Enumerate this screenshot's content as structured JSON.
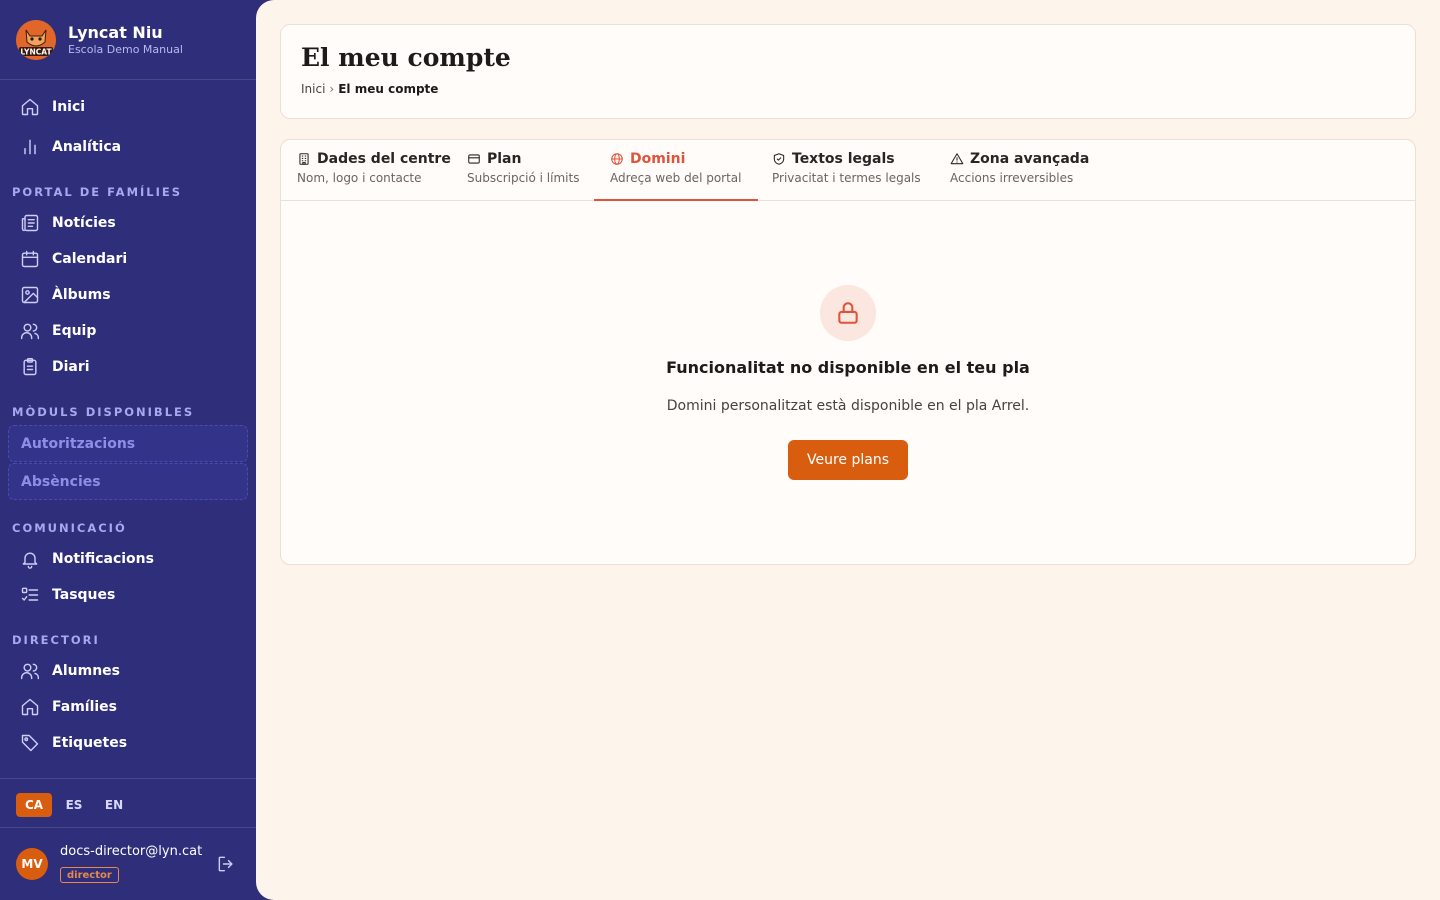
{
  "brand": {
    "name": "Lyncat Niu",
    "subtitle": "Escola Demo Manual",
    "logo_text": "LYNCAT"
  },
  "sidebar": {
    "main_items": [
      {
        "label": "Inici",
        "icon": "home-icon"
      },
      {
        "label": "Analítica",
        "icon": "bar-chart-icon"
      }
    ],
    "sections": [
      {
        "title": "PORTAL DE FAMÍLIES",
        "items": [
          {
            "label": "Notícies",
            "icon": "newspaper-icon"
          },
          {
            "label": "Calendari",
            "icon": "calendar-icon"
          },
          {
            "label": "Àlbums",
            "icon": "image-icon"
          },
          {
            "label": "Equip",
            "icon": "users-icon"
          },
          {
            "label": "Diari",
            "icon": "clipboard-icon"
          }
        ]
      },
      {
        "title": "MÒDULS DISPONIBLES",
        "items": [
          {
            "label": "Autoritzacions"
          },
          {
            "label": "Absències"
          }
        ]
      },
      {
        "title": "COMUNICACIÓ",
        "items": [
          {
            "label": "Notificacions",
            "icon": "bell-icon"
          },
          {
            "label": "Tasques",
            "icon": "checklist-icon"
          }
        ]
      },
      {
        "title": "DIRECTORI",
        "items": [
          {
            "label": "Alumnes",
            "icon": "users-icon"
          },
          {
            "label": "Famílies",
            "icon": "home-icon"
          },
          {
            "label": "Etiquetes",
            "icon": "tag-icon"
          }
        ]
      }
    ],
    "languages": [
      {
        "code": "CA",
        "active": true
      },
      {
        "code": "ES",
        "active": false
      },
      {
        "code": "EN",
        "active": false
      }
    ],
    "user": {
      "initials": "MV",
      "email": "docs-director@lyn.cat",
      "role": "director"
    }
  },
  "header": {
    "title": "El meu compte",
    "breadcrumb": {
      "home": "Inici",
      "separator": "›",
      "current": "El meu compte"
    }
  },
  "tabs": [
    {
      "title": "Dades del centre",
      "subtitle": "Nom, logo i contacte",
      "icon": "building-icon",
      "active": false
    },
    {
      "title": "Plan",
      "subtitle": "Subscripció i límits",
      "icon": "credit-card-icon",
      "active": false
    },
    {
      "title": "Domini",
      "subtitle": "Adreça web del portal",
      "icon": "globe-icon",
      "active": true
    },
    {
      "title": "Textos legals",
      "subtitle": "Privacitat i termes legals",
      "icon": "shield-check-icon",
      "active": false
    },
    {
      "title": "Zona avançada",
      "subtitle": "Accions irreversibles",
      "icon": "warning-icon",
      "active": false
    }
  ],
  "locked_panel": {
    "icon": "lock-icon",
    "title": "Funcionalitat no disponible en el teu pla",
    "description": "Domini personalitzat està disponible en el pla Arrel.",
    "button_label": "Veure plans"
  },
  "colors": {
    "sidebar_bg": "#2e2e7a",
    "accent_orange": "#d95d0f",
    "active_tab": "#e0533b",
    "main_bg": "#fdf4ec"
  }
}
